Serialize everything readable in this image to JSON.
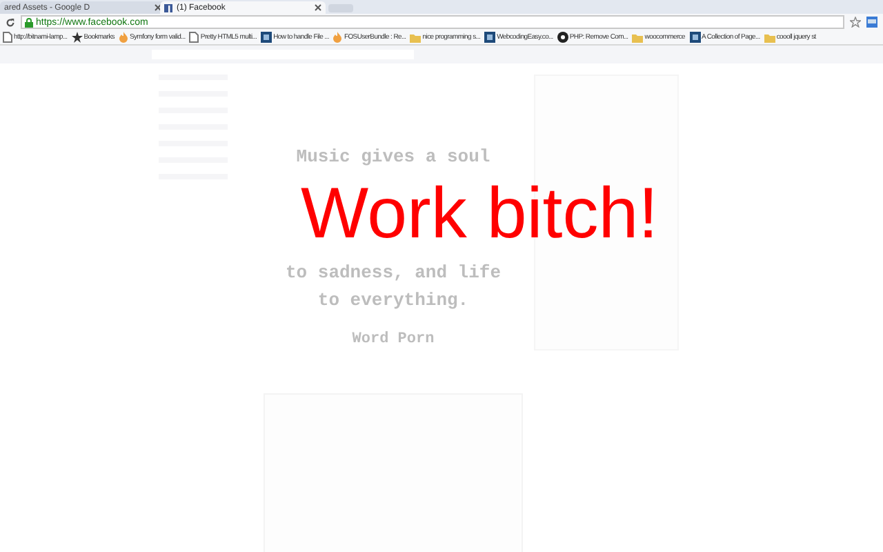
{
  "tabs": [
    {
      "label": "ared Assets - Google D",
      "selected": false
    },
    {
      "label": "(1) Facebook",
      "selected": true
    }
  ],
  "address_bar": {
    "url": "https://www.facebook.com"
  },
  "bookmarks": [
    {
      "label": "http://bitnami-lamp...",
      "kind": "page"
    },
    {
      "label": "Bookmarks",
      "kind": "star"
    },
    {
      "label": "Symfony form valid...",
      "kind": "flame"
    },
    {
      "label": "Pretty HTML5 multi...",
      "kind": "page"
    },
    {
      "label": "How to handle File ...",
      "kind": "site"
    },
    {
      "label": "FOSUserBundle : Re...",
      "kind": "flame"
    },
    {
      "label": "nice programming s...",
      "kind": "folder"
    },
    {
      "label": "WebcodingEasy.co...",
      "kind": "site"
    },
    {
      "label": "PHP: Remove Com...",
      "kind": "globe"
    },
    {
      "label": "woocommerce",
      "kind": "folder"
    },
    {
      "label": "A Collection of Page...",
      "kind": "site"
    },
    {
      "label": "coooll jquery st",
      "kind": "folder"
    }
  ],
  "post": {
    "quote_lines": [
      "Music gives a soul",
      "to sadness, and life",
      "to everything."
    ],
    "source": "Word Porn"
  },
  "overlay": {
    "text": "Work bitch!"
  }
}
